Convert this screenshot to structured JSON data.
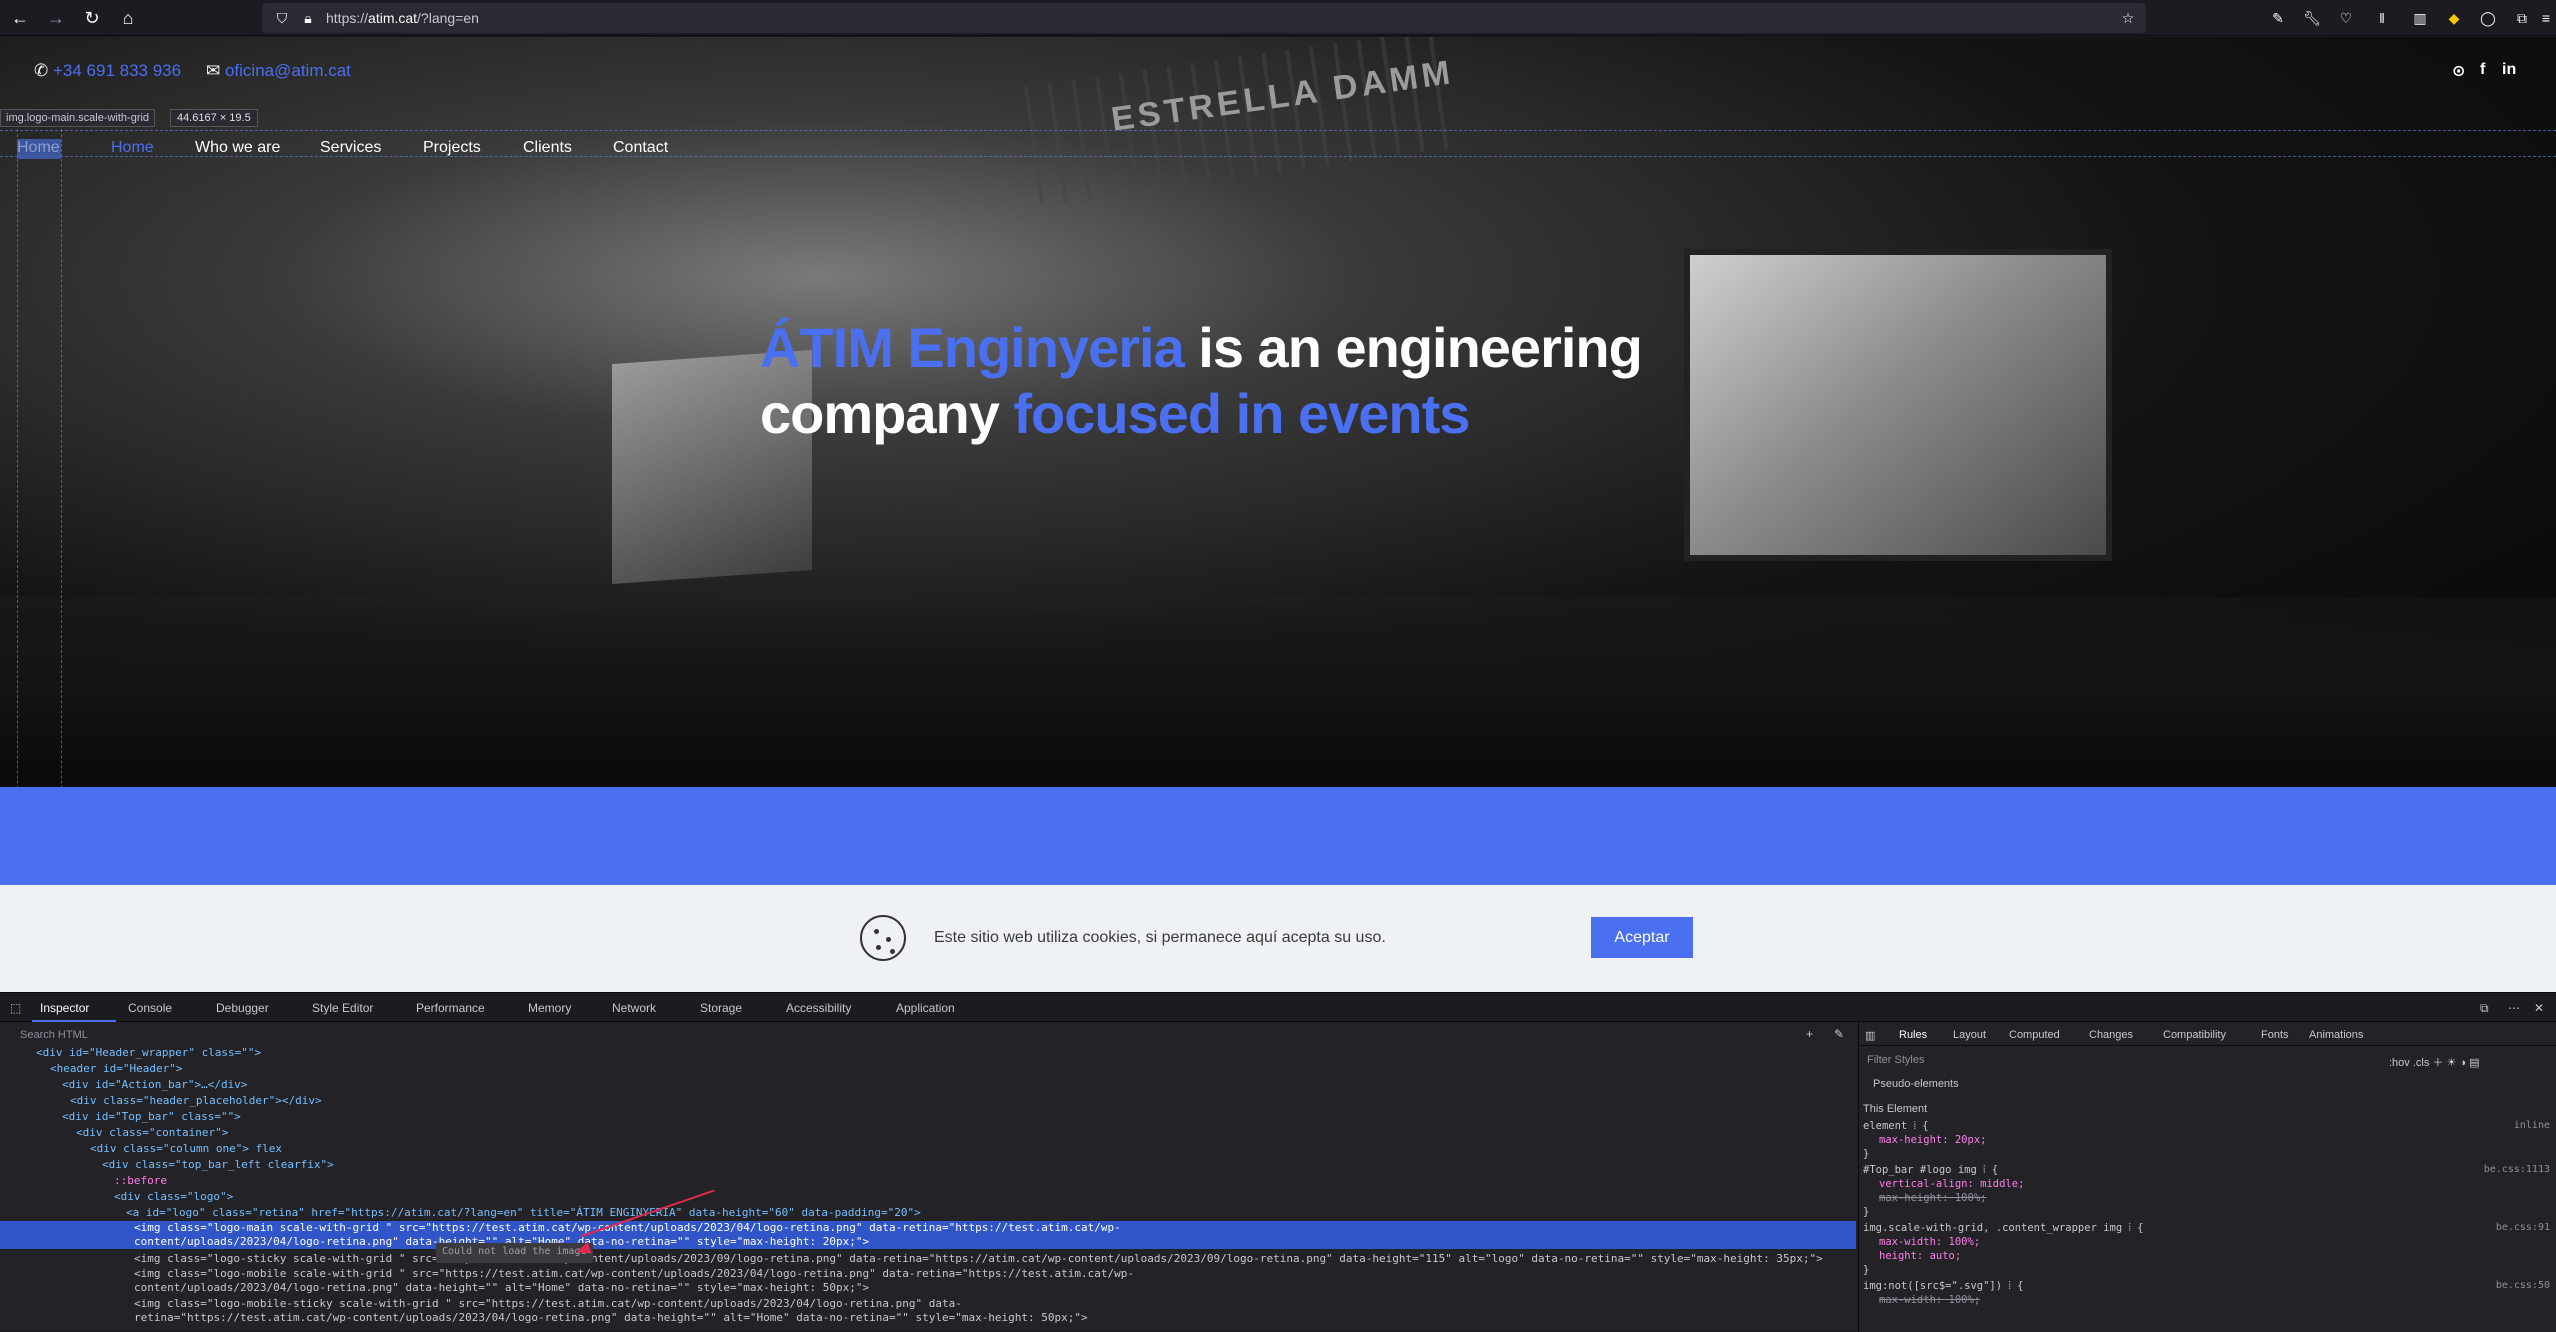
{
  "browser": {
    "url_prefix": "https://",
    "url_host": "atim.cat",
    "url_rest": "/?lang=en"
  },
  "site": {
    "phone": "+34 691 833 936",
    "email": "oficina@atim.cat",
    "social": [
      "⊙",
      "f",
      "in"
    ],
    "grid_tooltip_selector": "img.logo-main.scale-with-grid",
    "grid_tooltip_size": "44.6167 × 19.5",
    "logo_alt_text": "Home",
    "menu": [
      "Home",
      "Who we are",
      "Services",
      "Projects",
      "Clients",
      "Contact"
    ],
    "banner_text": "ESTRELLA DAMM",
    "headline_part1": "ÁTIM Enginyeria",
    "headline_part2": " is an engineering company ",
    "headline_part3": "focused in events",
    "cookie_text": "Este sitio web utiliza cookies, si permanece aquí acepta su uso.",
    "cookie_button": "Aceptar"
  },
  "devtools": {
    "tabs": [
      "Inspector",
      "Console",
      "Debugger",
      "Style Editor",
      "Performance",
      "Memory",
      "Network",
      "Storage",
      "Accessibility",
      "Application"
    ],
    "search_placeholder": "Search HTML",
    "tree": [
      "<div id=\"Header_wrapper\" class=\"\">",
      "<header id=\"Header\">",
      "<div id=\"Action_bar\">…</div>",
      "<div class=\"header_placeholder\"></div>",
      "<div id=\"Top_bar\" class=\"\">",
      "<div class=\"container\">",
      "<div class=\"column one\"> flex",
      "<div class=\"top_bar_left clearfix\">",
      "::before",
      "<div class=\"logo\">",
      "<a id=\"logo\" class=\"retina\" href=\"https://atim.cat/?lang=en\" title=\"ÁTIM ENGINYERIA\" data-height=\"60\" data-padding=\"20\">",
      "<img class=\"logo-main scale-with-grid \" src=\"https://test.atim.cat/wp-content/uploads/2023/04/logo-retina.png\" data-retina=\"https://test.atim.cat/wp-content/uploads/2023/04/logo-retina.png\" data-height=\"\" alt=\"Home\" data-no-retina=\"\" style=\"max-height: 20px;\">",
      "<img class=\"logo-sticky scale-with-grid \" src=\"https://atim.cat/wp-content/uploads/2023/09/logo-retina.png\" data-retina=\"https://atim.cat/wp-content/uploads/2023/09/logo-retina.png\" data-height=\"115\" alt=\"logo\" data-no-retina=\"\" style=\"max-height: 35px;\">",
      "<img class=\"logo-mobile scale-with-grid \" src=\"https://test.atim.cat/wp-content/uploads/2023/04/logo-retina.png\" data-retina=\"https://test.atim.cat/wp-content/uploads/2023/04/logo-retina.png\" data-height=\"\" alt=\"Home\" data-no-retina=\"\" style=\"max-height: 50px;\">",
      "<img class=\"logo-mobile-sticky scale-with-grid \" src=\"https://test.atim.cat/wp-content/uploads/2023/04/logo-retina.png\" data-retina=\"https://test.atim.cat/wp-content/uploads/2023/04/logo-retina.png\" data-height=\"\" alt=\"Home\" data-no-retina=\"\" style=\"max-height: 50px;\">"
    ],
    "error_tooltip": "Could not load the image",
    "rules_tabs": [
      "Rules",
      "Layout",
      "Computed",
      "Changes",
      "Compatibility",
      "Fonts",
      "Animations"
    ],
    "filter_placeholder": "Filter Styles",
    "pseudo": "Pseudo-elements",
    "this_element": "This Element",
    "rules": [
      {
        "sel": "element ⦙ {",
        "src": "inline",
        "props": [
          "max-height: 20px;"
        ]
      },
      {
        "sel": "#Top_bar #logo img ⦙ {",
        "src": "be.css:1113",
        "props": [
          "vertical-align: middle;",
          "max-height: 100%;"
        ]
      },
      {
        "sel": "img.scale-with-grid, .content_wrapper img ⦙ {",
        "src": "be.css:91",
        "props": [
          "max-width: 100%;",
          "height: auto;"
        ]
      },
      {
        "sel": "img:not([src$=\".svg\"]) ⦙ {",
        "src": "be.css:50",
        "props": [
          "max-width: 100%;"
        ]
      }
    ]
  }
}
